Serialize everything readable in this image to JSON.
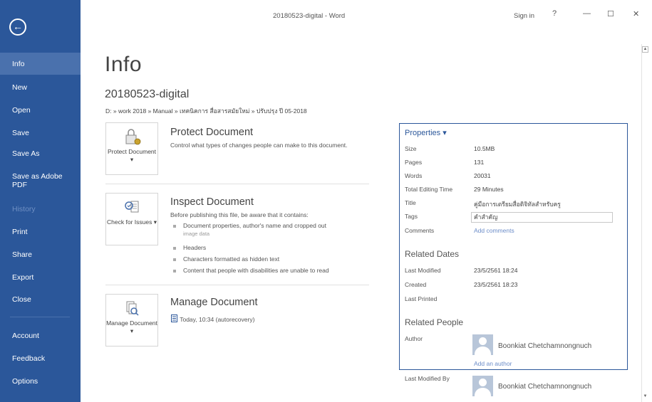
{
  "window": {
    "title": "20180523-digital  -  Word",
    "sign_in": "Sign in",
    "help": "?",
    "minimize": "—",
    "restore": "☐",
    "close": "✕"
  },
  "sidebar": {
    "back": "←",
    "items": [
      {
        "label": "Info"
      },
      {
        "label": "New"
      },
      {
        "label": "Open"
      },
      {
        "label": "Save"
      },
      {
        "label": "Save As"
      },
      {
        "label": "Save as Adobe PDF"
      },
      {
        "label": "History"
      },
      {
        "label": "Print"
      },
      {
        "label": "Share"
      },
      {
        "label": "Export"
      },
      {
        "label": "Close"
      },
      {
        "label": "Account"
      },
      {
        "label": "Feedback"
      },
      {
        "label": "Options"
      }
    ]
  },
  "main": {
    "title": "Info",
    "file_name": "20180523-digital",
    "file_path": "D: » work 2018 » Manual » เทคนิคการ สื่อสารสมัยใหม่ » ปรับปรุง ปี 05-2018",
    "protect": {
      "button": "Protect Document ▾",
      "title": "Protect Document",
      "desc": "Control what types of changes people can make to this document."
    },
    "inspect": {
      "button": "Check for Issues ▾",
      "title": "Inspect Document",
      "desc": "Before publishing this file, be aware that it contains:",
      "bullets": [
        {
          "text": "Document properties, author's name and cropped out",
          "sub": "image data"
        },
        {
          "text": "Headers"
        },
        {
          "text": "Characters formatted as hidden text"
        },
        {
          "text": "Content that people with disabilities are unable to read"
        }
      ]
    },
    "manage": {
      "button": "Manage Document ▾",
      "title": "Manage Document",
      "autorecovery": "Today, 10:34 (autorecovery)"
    }
  },
  "properties": {
    "header": "Properties ▾",
    "rows": [
      {
        "label": "Size",
        "value": "10.5MB"
      },
      {
        "label": "Pages",
        "value": "131"
      },
      {
        "label": "Words",
        "value": "20031"
      },
      {
        "label": "Total Editing Time",
        "value": "29 Minutes"
      },
      {
        "label": "Title",
        "value": "คู่มือการเตรียมสื่อดิจิทัลสำหรับครู"
      },
      {
        "label": "Tags",
        "value": "คำสำคัญ"
      },
      {
        "label": "Comments",
        "value": "Add comments"
      }
    ],
    "related_dates": {
      "header": "Related Dates",
      "rows": [
        {
          "label": "Last Modified",
          "value": "23/5/2561 18:24"
        },
        {
          "label": "Created",
          "value": "23/5/2561 18:23"
        },
        {
          "label": "Last Printed",
          "value": ""
        }
      ]
    },
    "related_people": {
      "header": "Related People",
      "author_label": "Author",
      "author_name": "Boonkiat Chetchamnongnuch",
      "add_author": "Add an author",
      "last_modified_by_label": "Last Modified By",
      "last_modified_by": "Boonkiat Chetchamnongnuch"
    }
  },
  "colors": {
    "accent": "#2b579a",
    "sidebar_active": "#4a71ad"
  },
  "icons": {
    "back": "back-arrow-icon",
    "protect": "lock-icon",
    "inspect": "inspect-icon",
    "manage": "manage-document-icon",
    "autorecovery": "document-icon"
  }
}
